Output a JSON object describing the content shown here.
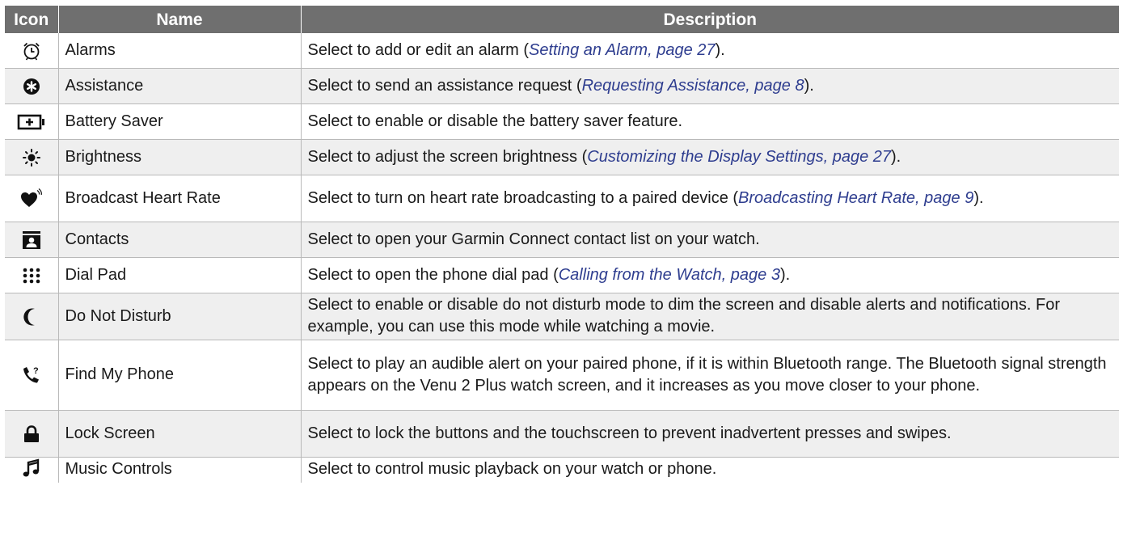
{
  "header": {
    "icon": "Icon",
    "name": "Name",
    "description": "Description"
  },
  "colors": {
    "header_bg": "#6f6f6f",
    "link": "#2e3d8f",
    "alt_row": "#efefef"
  },
  "rows": [
    {
      "icon": "alarm-clock-icon",
      "name": "Alarms",
      "desc_pre": "Select to add or edit an alarm (",
      "link": "Setting an Alarm, page 27",
      "desc_post": ")."
    },
    {
      "icon": "assistance-icon",
      "name": "Assistance",
      "desc_pre": "Select to send an assistance request (",
      "link": "Requesting Assistance, page 8",
      "desc_post": ")."
    },
    {
      "icon": "battery-saver-icon",
      "name": "Battery Saver",
      "desc_pre": "Select to enable or disable the battery saver feature.",
      "link": "",
      "desc_post": ""
    },
    {
      "icon": "brightness-icon",
      "name": "Brightness",
      "desc_pre": "Select to adjust the screen brightness (",
      "link": "Customizing the Display Settings, page 27",
      "desc_post": ")."
    },
    {
      "icon": "broadcast-heart-rate-icon",
      "name": "Broadcast Heart Rate",
      "desc_pre": "Select to turn on heart rate broadcasting to a paired device (",
      "link": "Broadcasting Heart Rate, page 9",
      "desc_post": ")."
    },
    {
      "icon": "contacts-icon",
      "name": "Contacts",
      "desc_pre": "Select to open your Garmin Connect contact list on your watch.",
      "link": "",
      "desc_post": ""
    },
    {
      "icon": "dial-pad-icon",
      "name": "Dial Pad",
      "desc_pre": "Select to open the phone dial pad (",
      "link": "Calling from the Watch, page 3",
      "desc_post": ")."
    },
    {
      "icon": "moon-icon",
      "name": "Do Not Disturb",
      "desc_pre": "Select to enable or disable do not disturb mode to dim the screen and disable alerts and notifications. For example, you can use this mode while watching a movie.",
      "link": "",
      "desc_post": ""
    },
    {
      "icon": "find-phone-icon",
      "name": "Find My Phone",
      "desc_pre": "Select to play an audible alert on your paired phone, if it is within Bluetooth range. The Bluetooth signal strength appears on the Venu 2 Plus watch screen, and it increases as you move closer to your phone.",
      "link": "",
      "desc_post": ""
    },
    {
      "icon": "lock-icon",
      "name": "Lock Screen",
      "desc_pre": "Select to lock the buttons and the touchscreen to prevent inadvertent presses and swipes.",
      "link": "",
      "desc_post": ""
    },
    {
      "icon": "music-note-icon",
      "name": "Music Controls",
      "desc_pre": "Select to control music playback on your watch or phone.",
      "link": "",
      "desc_post": ""
    }
  ]
}
